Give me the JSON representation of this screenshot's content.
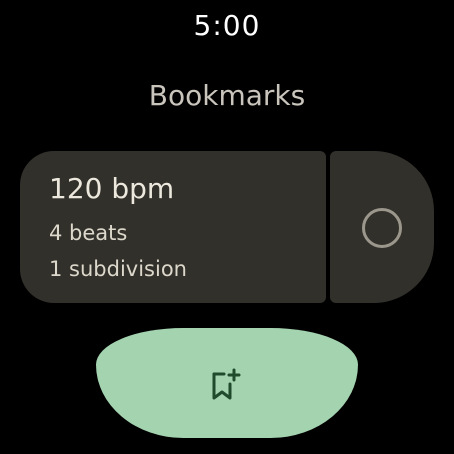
{
  "status_bar": {
    "time": "5:00"
  },
  "header": {
    "title": "Bookmarks"
  },
  "bookmarks": [
    {
      "bpm_label": "120 bpm",
      "beats_label": "4 beats",
      "subdivision_label": "1 subdivision",
      "selected": false
    }
  ],
  "actions": {
    "add_bookmark_icon": "bookmark-add-icon"
  },
  "colors": {
    "background": "#000000",
    "card": "#32302a",
    "accent_button": "#a4d3b0",
    "icon_dark": "#1f4a2c"
  }
}
